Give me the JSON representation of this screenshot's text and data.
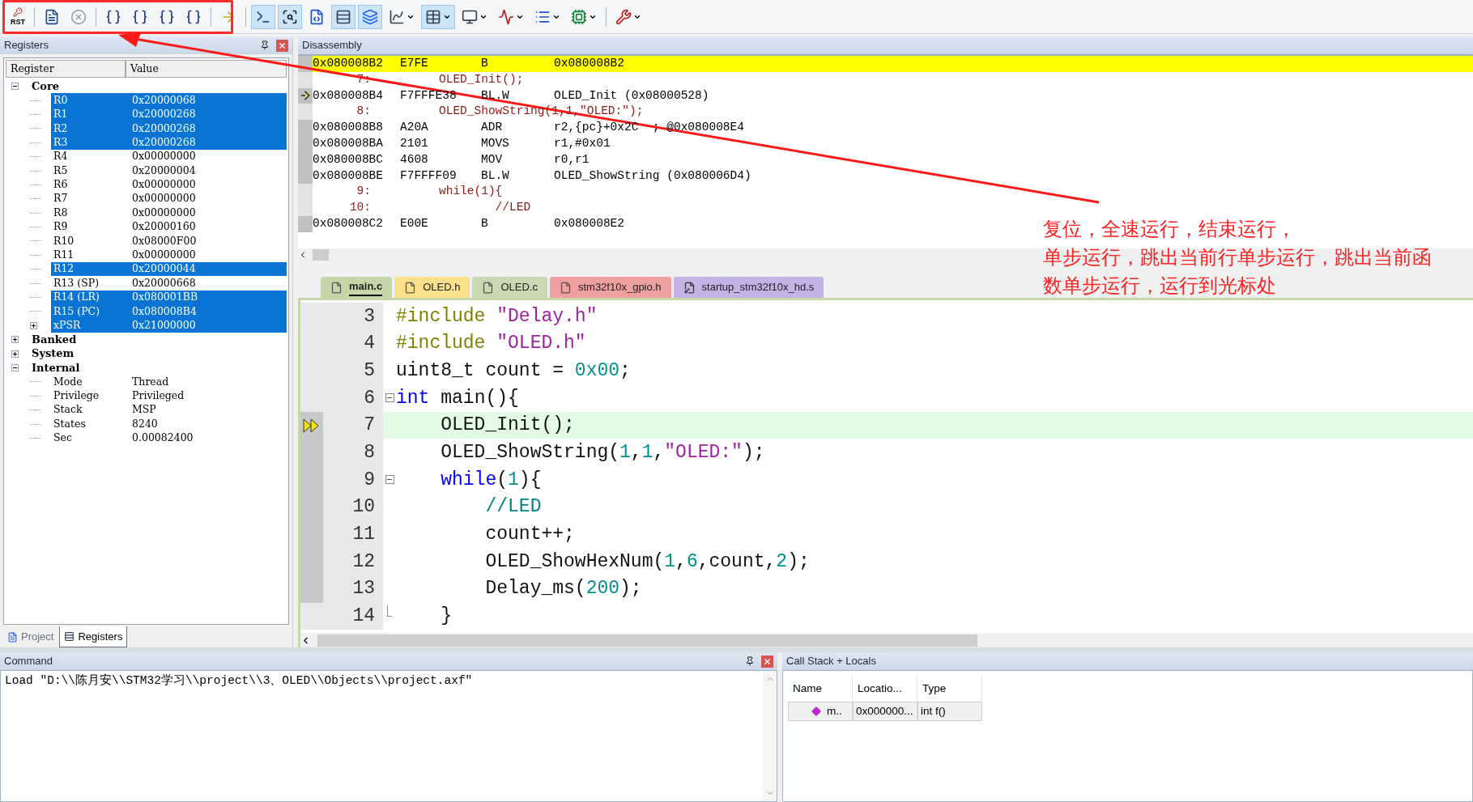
{
  "toolbar": {
    "buttons": [
      {
        "kind": "reset",
        "label": "RST",
        "selected": false,
        "dropdown": false
      },
      {
        "kind": "run",
        "selected": false,
        "dropdown": false
      },
      {
        "kind": "stop",
        "selected": false,
        "dropdown": false
      },
      {
        "kind": "step",
        "selected": false,
        "dropdown": false
      },
      {
        "kind": "step",
        "selected": false,
        "dropdown": false
      },
      {
        "kind": "step",
        "selected": false,
        "dropdown": false
      },
      {
        "kind": "step",
        "selected": false,
        "dropdown": false
      },
      {
        "kind": "run_to_cursor",
        "selected": false,
        "dropdown": false
      },
      {
        "kind": "command",
        "selected": true,
        "dropdown": false
      },
      {
        "kind": "disassembly",
        "selected": true,
        "dropdown": false
      },
      {
        "kind": "symbols",
        "selected": false,
        "dropdown": false
      },
      {
        "kind": "registers",
        "selected": true,
        "dropdown": false
      },
      {
        "kind": "call_stack",
        "selected": true,
        "dropdown": false
      },
      {
        "kind": "watch",
        "selected": false,
        "dropdown": true
      },
      {
        "kind": "memory",
        "selected": true,
        "dropdown": true
      },
      {
        "kind": "serial",
        "selected": false,
        "dropdown": true
      },
      {
        "kind": "analyzer",
        "selected": false,
        "dropdown": true
      },
      {
        "kind": "trace",
        "selected": false,
        "dropdown": true
      },
      {
        "kind": "system_viewer",
        "selected": false,
        "dropdown": true
      },
      {
        "kind": "toolbox",
        "selected": false,
        "dropdown": true
      }
    ]
  },
  "registers_panel": {
    "title": "Registers",
    "columns": [
      "Register",
      "Value"
    ],
    "tree": [
      {
        "label": "Core",
        "expanded": true,
        "children": [
          {
            "label": "R0",
            "value": "0x20000068",
            "selected": true
          },
          {
            "label": "R1",
            "value": "0x20000268",
            "selected": true
          },
          {
            "label": "R2",
            "value": "0x20000268",
            "selected": true
          },
          {
            "label": "R3",
            "value": "0x20000268",
            "selected": true
          },
          {
            "label": "R4",
            "value": "0x00000000",
            "selected": false
          },
          {
            "label": "R5",
            "value": "0x20000004",
            "selected": false
          },
          {
            "label": "R6",
            "value": "0x00000000",
            "selected": false
          },
          {
            "label": "R7",
            "value": "0x00000000",
            "selected": false
          },
          {
            "label": "R8",
            "value": "0x00000000",
            "selected": false
          },
          {
            "label": "R9",
            "value": "0x20000160",
            "selected": false
          },
          {
            "label": "R10",
            "value": "0x08000F00",
            "selected": false
          },
          {
            "label": "R11",
            "value": "0x00000000",
            "selected": false
          },
          {
            "label": "R12",
            "value": "0x20000044",
            "selected": true
          },
          {
            "label": "R13 (SP)",
            "value": "0x20000668",
            "selected": false
          },
          {
            "label": "R14 (LR)",
            "value": "0x080001BB",
            "selected": true
          },
          {
            "label": "R15 (PC)",
            "value": "0x080008B4",
            "selected": true
          },
          {
            "label": "xPSR",
            "value": "0x21000000",
            "selected": true,
            "expanded": false
          }
        ]
      },
      {
        "label": "Banked",
        "expanded": false
      },
      {
        "label": "System",
        "expanded": false
      },
      {
        "label": "Internal",
        "expanded": true,
        "children": [
          {
            "label": "Mode",
            "value": "Thread",
            "selected": false
          },
          {
            "label": "Privilege",
            "value": "Privileged",
            "selected": false
          },
          {
            "label": "Stack",
            "value": "MSP",
            "selected": false
          },
          {
            "label": "States",
            "value": "8240",
            "selected": false
          },
          {
            "label": "Sec",
            "value": "0.00082400",
            "selected": false
          }
        ]
      }
    ],
    "tabs": [
      {
        "label": "Project",
        "selected": false
      },
      {
        "label": "Registers",
        "selected": true
      }
    ]
  },
  "disassembly": {
    "title": "Disassembly",
    "rows": [
      {
        "kind": "asm",
        "address": "0x080008B2",
        "code": "E7FE",
        "mnemonic": "B",
        "operand": "0x080008B2",
        "highlighted": true,
        "current": false
      },
      {
        "kind": "src",
        "line": "7:",
        "text": "OLED_Init();"
      },
      {
        "kind": "asm",
        "address": "0x080008B4",
        "code": "F7FFFE38",
        "mnemonic": "BL.W",
        "operand": "OLED_Init (0x08000528)",
        "highlighted": false,
        "current": true
      },
      {
        "kind": "src",
        "line": "8:",
        "text": "OLED_ShowString(1,1,\"OLED:\");"
      },
      {
        "kind": "asm",
        "address": "0x080008B8",
        "code": "A20A",
        "mnemonic": "ADR",
        "operand": "r2,{pc}+0x2C  ; @0x080008E4",
        "highlighted": false,
        "current": false
      },
      {
        "kind": "asm",
        "address": "0x080008BA",
        "code": "2101",
        "mnemonic": "MOVS",
        "operand": "r1,#0x01",
        "highlighted": false,
        "current": false
      },
      {
        "kind": "asm",
        "address": "0x080008BC",
        "code": "4608",
        "mnemonic": "MOV",
        "operand": "r0,r1",
        "highlighted": false,
        "current": false
      },
      {
        "kind": "asm",
        "address": "0x080008BE",
        "code": "F7FFFF09",
        "mnemonic": "BL.W",
        "operand": "OLED_ShowString (0x080006D4)",
        "highlighted": false,
        "current": false
      },
      {
        "kind": "src",
        "line": "9:",
        "text": "while(1){"
      },
      {
        "kind": "src",
        "line": "10:",
        "text": "        //LED"
      },
      {
        "kind": "asm",
        "address": "0x080008C2",
        "code": "E00E",
        "mnemonic": "B",
        "operand": "0x080008E2",
        "highlighted": false,
        "current": false
      }
    ]
  },
  "editor": {
    "tabs": [
      {
        "label": "main.c",
        "selected": true,
        "color": "#c5d6a8",
        "kind": "file"
      },
      {
        "label": "OLED.h",
        "selected": false,
        "color": "#fbe08c",
        "kind": "file"
      },
      {
        "label": "OLED.c",
        "selected": false,
        "color": "#c8d8b2",
        "kind": "file"
      },
      {
        "label": "stm32f10x_gpio.h",
        "selected": false,
        "color": "#ef9f9f",
        "kind": "file"
      },
      {
        "label": "startup_stm32f10x_hd.s",
        "selected": false,
        "color": "#c3b3e6",
        "kind": "startup"
      }
    ],
    "lines": [
      {
        "number": "3",
        "kind": "plain",
        "executable": false,
        "current": false,
        "tokens": [
          {
            "kind": "pre",
            "text": "#include "
          },
          {
            "kind": "str",
            "text": "\"Delay.h\""
          }
        ]
      },
      {
        "number": "4",
        "kind": "plain",
        "executable": false,
        "current": false,
        "tokens": [
          {
            "kind": "pre",
            "text": "#include "
          },
          {
            "kind": "str",
            "text": "\"OLED.h\""
          }
        ]
      },
      {
        "number": "5",
        "kind": "plain",
        "executable": false,
        "current": false,
        "tokens": [
          {
            "kind": "plain",
            "text": "uint8_t count = "
          },
          {
            "kind": "num",
            "text": "0x00"
          },
          {
            "kind": "plain",
            "text": ";"
          }
        ]
      },
      {
        "number": "6",
        "kind": "fold_start",
        "executable": false,
        "current": false,
        "tokens": [
          {
            "kind": "kw",
            "text": "int"
          },
          {
            "kind": "plain",
            "text": " main(){"
          }
        ]
      },
      {
        "number": "7",
        "kind": "plain",
        "executable": true,
        "current": true,
        "tokens": [
          {
            "kind": "plain",
            "text": "    OLED_Init();"
          }
        ]
      },
      {
        "number": "8",
        "kind": "plain",
        "executable": true,
        "current": false,
        "tokens": [
          {
            "kind": "plain",
            "text": "    OLED_ShowString("
          },
          {
            "kind": "num",
            "text": "1"
          },
          {
            "kind": "plain",
            "text": ","
          },
          {
            "kind": "num",
            "text": "1"
          },
          {
            "kind": "plain",
            "text": ","
          },
          {
            "kind": "str",
            "text": "\"OLED:\""
          },
          {
            "kind": "plain",
            "text": ");"
          }
        ]
      },
      {
        "number": "9",
        "kind": "fold_start",
        "executable": true,
        "current": false,
        "tokens": [
          {
            "kind": "kw",
            "text": "    while"
          },
          {
            "kind": "plain",
            "text": "("
          },
          {
            "kind": "num",
            "text": "1"
          },
          {
            "kind": "plain",
            "text": "){"
          }
        ]
      },
      {
        "number": "10",
        "kind": "plain",
        "executable": true,
        "current": false,
        "tokens": [
          {
            "kind": "comment",
            "text": "        //LED"
          }
        ]
      },
      {
        "number": "11",
        "kind": "plain",
        "executable": true,
        "current": false,
        "tokens": [
          {
            "kind": "plain",
            "text": "        count++;"
          }
        ]
      },
      {
        "number": "12",
        "kind": "plain",
        "executable": true,
        "current": false,
        "tokens": [
          {
            "kind": "plain",
            "text": "        OLED_ShowHexNum("
          },
          {
            "kind": "num",
            "text": "1"
          },
          {
            "kind": "plain",
            "text": ","
          },
          {
            "kind": "num",
            "text": "6"
          },
          {
            "kind": "plain",
            "text": ",count,"
          },
          {
            "kind": "num",
            "text": "2"
          },
          {
            "kind": "plain",
            "text": ");"
          }
        ]
      },
      {
        "number": "13",
        "kind": "plain",
        "executable": true,
        "current": false,
        "tokens": [
          {
            "kind": "plain",
            "text": "        Delay_ms("
          },
          {
            "kind": "num",
            "text": "200"
          },
          {
            "kind": "plain",
            "text": ");"
          }
        ]
      },
      {
        "number": "14",
        "kind": "fold_end",
        "executable": false,
        "current": false,
        "tokens": [
          {
            "kind": "plain",
            "text": "    }"
          }
        ]
      }
    ]
  },
  "command": {
    "title": "Command",
    "lines": [
      "Load \"D:\\\\陈月安\\\\STM32学习\\\\project\\\\3、OLED\\\\Objects\\\\project.axf\""
    ]
  },
  "call_stack": {
    "title": "Call Stack + Locals",
    "columns": [
      "Name",
      "Locatio...",
      "Type"
    ],
    "rows": [
      {
        "cells": [
          "m..",
          "0x000000...",
          "int f()"
        ]
      }
    ]
  },
  "annotation": {
    "lines": [
      "复位，全速运行，结束运行，",
      "单步运行，跳出当前行单步运行，跳出当前函",
      "数单步运行，运行到光标处"
    ]
  }
}
